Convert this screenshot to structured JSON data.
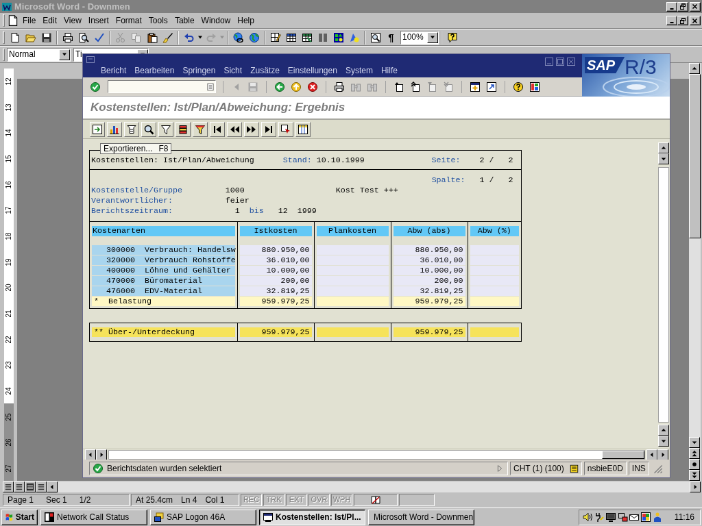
{
  "word": {
    "title": "Microsoft Word - Downmen",
    "menu": [
      "File",
      "Edit",
      "View",
      "Insert",
      "Format",
      "Tools",
      "Table",
      "Window",
      "Help"
    ],
    "show_marks": "¶",
    "zoom": "100%",
    "style": "Normal",
    "font": "Ti",
    "ruler": [
      "12",
      "13",
      "14",
      "15",
      "16",
      "17",
      "18",
      "19",
      "20",
      "21",
      "22",
      "23",
      "24",
      "25",
      "26",
      "27"
    ],
    "status": {
      "page": "Page 1",
      "section": "Sec 1",
      "pages": "1/2",
      "at": "At 25.4cm",
      "line": "Ln 4",
      "col": "Col 1",
      "modes": [
        {
          "label": "REC",
          "disabled": true
        },
        {
          "label": "TRK",
          "disabled": true
        },
        {
          "label": "EXT",
          "disabled": true
        },
        {
          "label": "OVR",
          "disabled": true
        },
        {
          "label": "WPH",
          "disabled": true
        }
      ]
    }
  },
  "sap": {
    "menu": [
      "Bericht",
      "Bearbeiten",
      "Springen",
      "Sicht",
      "Zusätze",
      "Einstellungen",
      "System",
      "Hilfe"
    ],
    "logo": {
      "brand": "SAP",
      "release": "R/3"
    },
    "title": "Kostenstellen: Ist/Plan/Abweichung: Ergebnis",
    "report": {
      "tooltip": {
        "label": "Exportieren...",
        "shortcut": "F8"
      },
      "heading": {
        "text": "Kostenstellen: Ist/Plan/Abweichung",
        "date_label": "Stand:",
        "date": "10.10.1999",
        "page_label": "Seite:",
        "page": "2 /",
        "page_total": "2"
      },
      "column": {
        "label": "Spalte:",
        "value": "1 /",
        "total": "2"
      },
      "cost_center": {
        "label": "Kostenstelle/Gruppe",
        "value": "1000",
        "description": "Kost Test +++"
      },
      "responsible": {
        "label": "Verantwortlicher:",
        "value": "feier"
      },
      "period": {
        "label": "Berichtszeitraum:",
        "from": "1",
        "connector": "bis",
        "to": "12",
        "year": "1999"
      },
      "columns": [
        "Kostenarten",
        "Istkosten",
        "Plankosten",
        "Abw (abs)",
        "Abw (%)"
      ],
      "rows": [
        {
          "kind": "item",
          "label": "300000  Verbrauch: Handelsw",
          "actual": "880.950,00",
          "variance": "880.950,00"
        },
        {
          "kind": "item",
          "label": "320000  Verbrauch Rohstoffe",
          "actual": "36.010,00",
          "variance": "36.010,00"
        },
        {
          "kind": "item",
          "label": "400000  Löhne und Gehälter",
          "actual": "10.000,00",
          "variance": "10.000,00"
        },
        {
          "kind": "item",
          "label": "470000  Büromaterial",
          "actual": "200,00",
          "variance": "200,00"
        },
        {
          "kind": "item",
          "label": "476000  EDV-Material",
          "actual": "32.819,25",
          "variance": "32.819,25"
        },
        {
          "kind": "subtotal",
          "label": "*  Belastung",
          "actual": "959.979,25",
          "variance": "959.979,25"
        }
      ],
      "total": {
        "kind": "total",
        "label": "** Über-/Unterdeckung",
        "actual": "959.979,25",
        "variance": "959.979,25"
      }
    },
    "status": {
      "message": "Berichtsdaten wurden selektiert",
      "system": "CHT (1) (100)",
      "server": "nsbieE0D",
      "mode": "INS"
    }
  },
  "taskbar": {
    "start": "Start",
    "tasks": [
      {
        "label": "Network Call Status",
        "selected": false
      },
      {
        "label": "SAP Logon 46A",
        "selected": false
      },
      {
        "label": "Kostenstellen: Ist/Pl...",
        "selected": true
      },
      {
        "label": "Microsoft Word - Downmen",
        "selected": false
      }
    ],
    "clock": "11:16"
  }
}
